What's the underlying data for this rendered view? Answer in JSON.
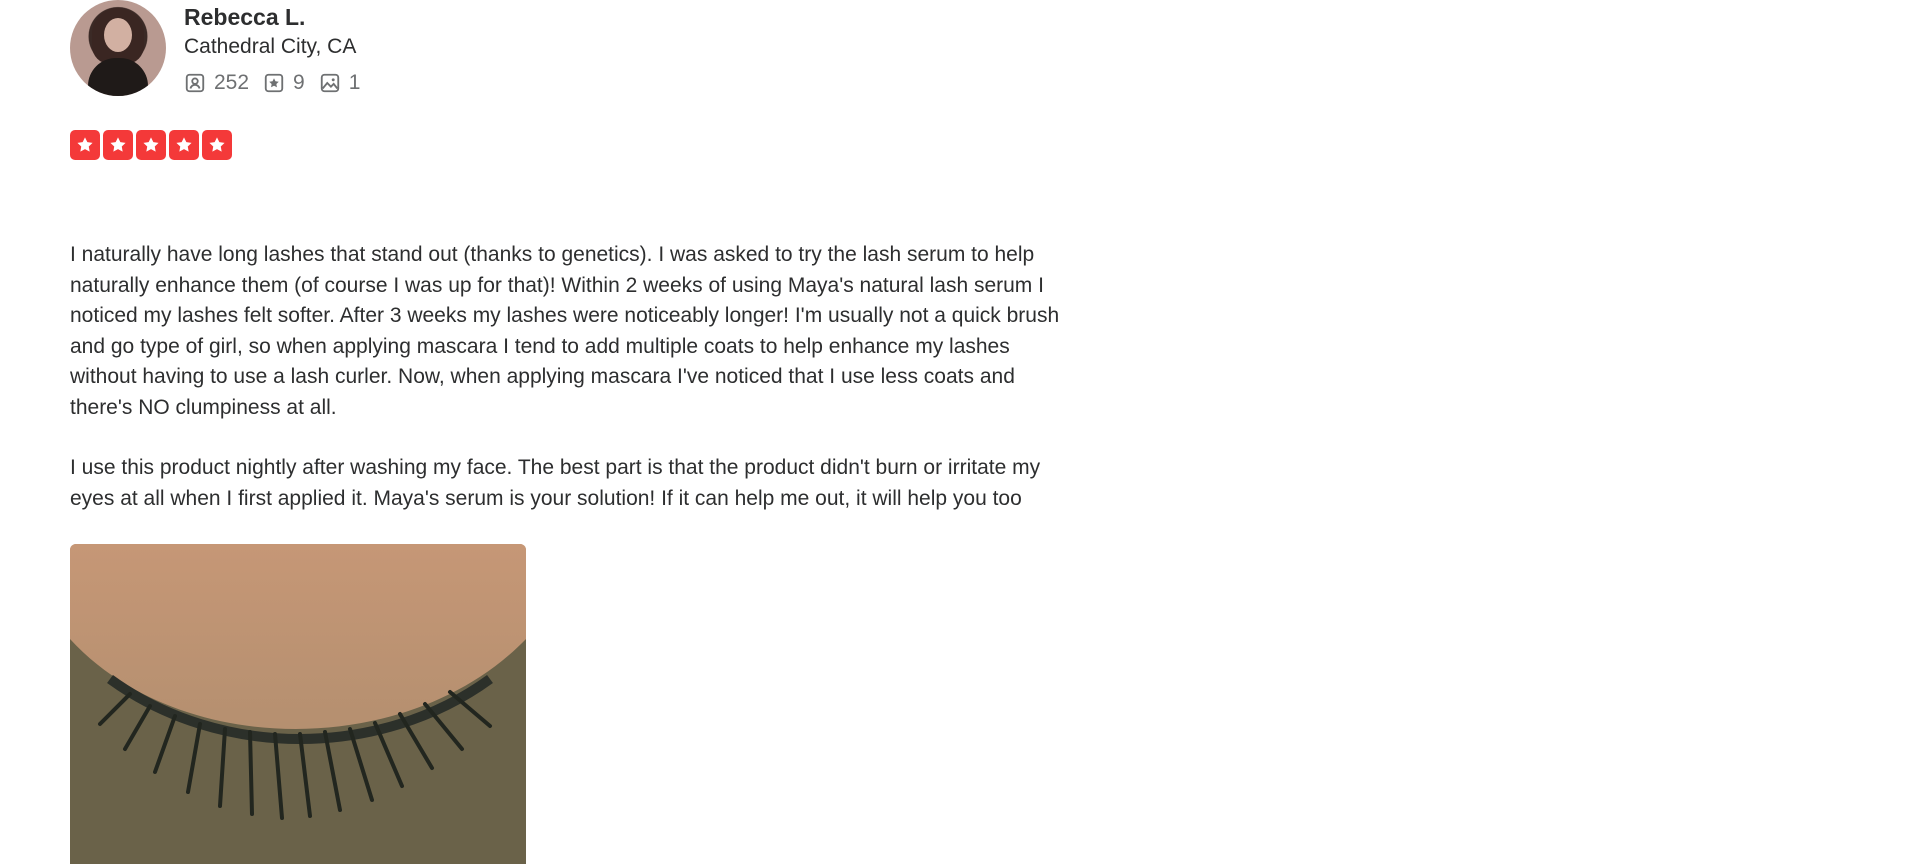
{
  "reviewer": {
    "name": "Rebecca L.",
    "location": "Cathedral City, CA",
    "stats": {
      "friends": "252",
      "reviews": "9",
      "photos": "1"
    }
  },
  "review": {
    "rating": 5,
    "rating_max": 5,
    "star_color": "#f43939",
    "paragraphs": [
      "I naturally have long lashes that stand out (thanks to genetics). I was asked to try the lash serum to help naturally enhance them (of course I was up for that)! Within 2 weeks of using Maya's natural lash serum I noticed my lashes felt softer. After 3 weeks my lashes were noticeably longer! I'm usually not a quick brush and go type of girl, so when applying mascara I tend to add multiple coats to help enhance my lashes without having to use a lash curler. Now, when applying mascara I've noticed that I use less coats and there's NO clumpiness at all.",
      "I use this product nightly after washing my face. The best part is that the product didn't burn or irritate my eyes at all when I first applied it. Maya's serum is your solution! If it can help me out, it will help you too"
    ]
  },
  "icons": {
    "friends": "friends-icon",
    "reviews": "star-outline-icon",
    "photos": "photo-icon",
    "star": "star-icon"
  }
}
